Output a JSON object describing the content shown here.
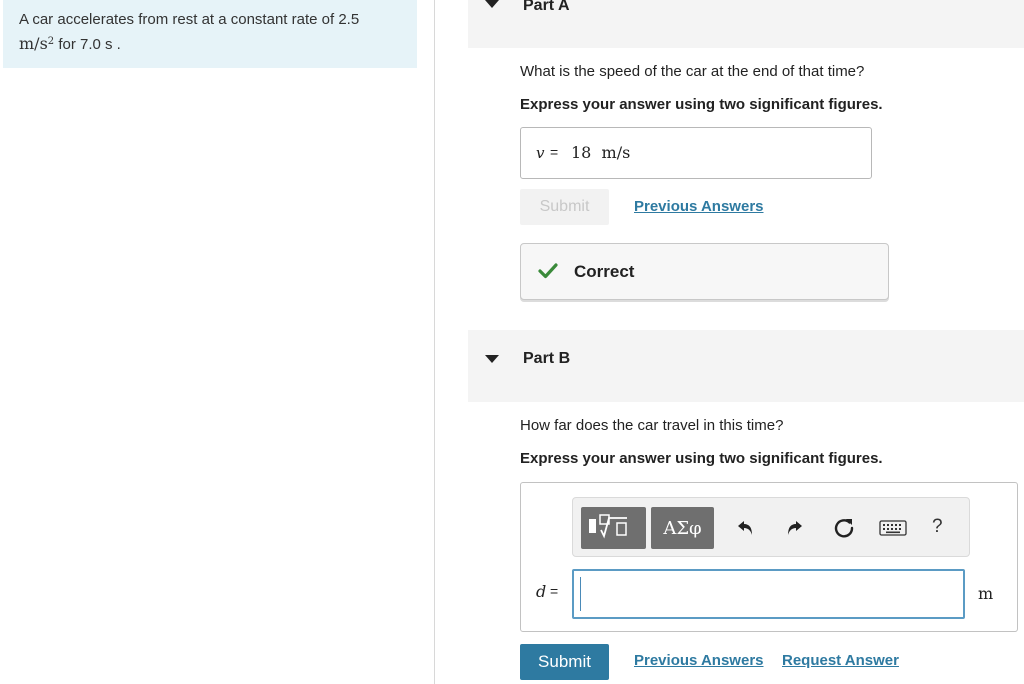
{
  "problem": {
    "text_before": "A car accelerates from rest at a constant rate of 2.5",
    "unit_base": "m/s",
    "unit_exp": "2",
    "text_after": " for 7.0 s ."
  },
  "part_a": {
    "title": "Part A",
    "question": "What is the speed of the car at the end of that time?",
    "instruction": "Express your answer using two significant figures.",
    "answer_var": "v",
    "answer_eq": "=",
    "answer_value": "18  m/s",
    "submit_label": "Submit",
    "previous_answers_label": "Previous Answers",
    "feedback": "Correct"
  },
  "part_b": {
    "title": "Part B",
    "question": "How far does the car travel in this time?",
    "instruction": "Express your answer using two significant figures.",
    "templates_label": "",
    "greek_label": "ΑΣφ",
    "answer_var": "d",
    "answer_eq": "=",
    "input_value": "",
    "unit": "m",
    "help_label": "?",
    "submit_label": "Submit",
    "previous_answers_label": "Previous Answers",
    "request_answer_label": "Request Answer"
  },
  "icons": [
    "caret-down-icon",
    "check-icon",
    "templates-icon",
    "undo-icon",
    "redo-icon",
    "reset-icon",
    "keyboard-icon",
    "help-icon"
  ],
  "colors": {
    "accent": "#2e7aa1",
    "problem_bg": "#e6f3f8",
    "correct_check": "#3a8a3a",
    "part_header_bg": "#f4f4f4"
  }
}
